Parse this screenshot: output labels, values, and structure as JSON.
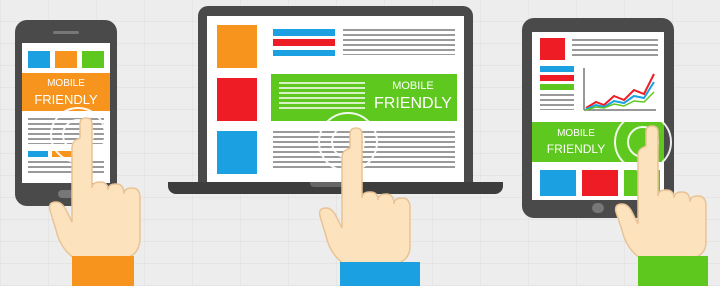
{
  "colors": {
    "orange": "#f7941d",
    "red": "#ee1c24",
    "blue": "#1ba1e2",
    "green": "#5fc81e",
    "device": "#4a4a4a",
    "skin": "#fde3bd",
    "text_lines": "#9a9a9a",
    "background": "#ededed"
  },
  "phone": {
    "banner_line1": "MOBILE",
    "banner_line2": "FRIENDLY",
    "banner_color": "orange",
    "sleeve_color": "orange"
  },
  "laptop": {
    "banner_line1": "MOBILE",
    "banner_line2": "FRIENDLY",
    "banner_color": "green",
    "sleeve_color": "blue"
  },
  "tablet": {
    "banner_line1": "MOBILE",
    "banner_line2": "FRIENDLY",
    "banner_color": "green",
    "sleeve_color": "green"
  },
  "icons": [
    "phone-icon",
    "laptop-icon",
    "tablet-icon",
    "pointing-hand-icon",
    "touch-ripple-icon",
    "line-chart-icon"
  ]
}
